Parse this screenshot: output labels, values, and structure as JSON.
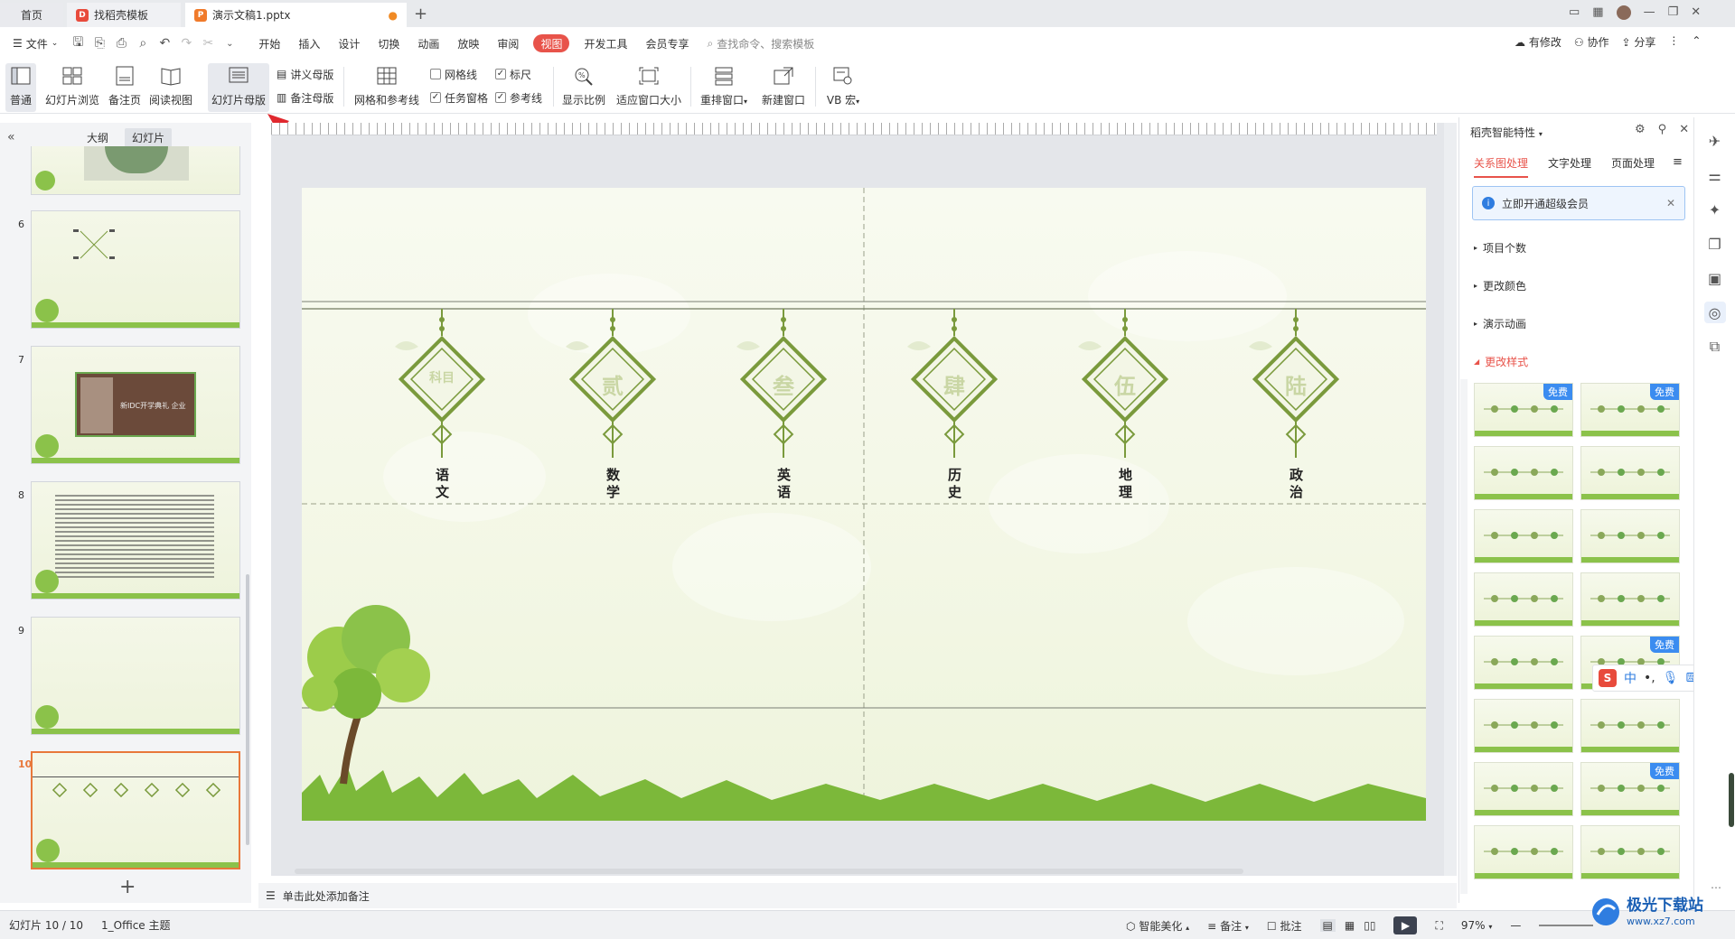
{
  "tabs": {
    "home": "首页",
    "docer": "找稻壳模板",
    "doc": "演示文稿1.pptx"
  },
  "menu": {
    "file": "文件",
    "items": [
      "开始",
      "插入",
      "设计",
      "切换",
      "动画",
      "放映",
      "审阅",
      "视图",
      "开发工具",
      "会员专享"
    ],
    "active": "视图",
    "search_placeholder": "查找命令、搜索模板",
    "right": [
      "有修改",
      "协作",
      "分享"
    ]
  },
  "ribbon": {
    "normal": "普通",
    "slide_sorter": "幻灯片浏览",
    "notes_page": "备注页",
    "reading_view": "阅读视图",
    "slide_master": "幻灯片母版",
    "handout_master": "讲义母版",
    "notes_master": "备注母版",
    "grid_guides": "网格和参考线",
    "gridlines": "网格线",
    "ruler": "标尺",
    "task_pane": "任务窗格",
    "guides": "参考线",
    "zoom": "显示比例",
    "fit_window": "适应窗口大小",
    "rearrange": "重排窗口",
    "new_window": "新建窗口",
    "vb_macro": "VB 宏"
  },
  "left_panel": {
    "tab_outline": "大纲",
    "tab_slides": "幻灯片",
    "slide_numbers": [
      "6",
      "7",
      "8",
      "9",
      "10"
    ],
    "thumb7_caption": "新IDC开学典礼 企业"
  },
  "slide": {
    "tags": [
      "科目",
      "贰",
      "叁",
      "肆",
      "伍",
      "陆"
    ],
    "subjects": [
      "语文",
      "数学",
      "英语",
      "历史",
      "地理",
      "政治"
    ]
  },
  "notes_placeholder": "单击此处添加备注",
  "right_panel": {
    "title": "稻壳智能特性",
    "tabs": [
      "关系图处理",
      "文字处理",
      "页面处理"
    ],
    "vip_banner": "立即开通超级会员",
    "sections": [
      "项目个数",
      "更改颜色",
      "演示动画",
      "更改样式"
    ],
    "free_badge": "免费"
  },
  "ime": {
    "label": "中"
  },
  "status": {
    "slide_info": "幻灯片 10 / 10",
    "theme": "1_Office 主题",
    "beautify": "智能美化",
    "notes": "备注",
    "comments": "批注",
    "zoom": "97%"
  },
  "watermark": {
    "name": "极光下载站",
    "url": "www.xz7.com"
  },
  "colors": {
    "accent": "#e8534a",
    "tag_green": "#7a9a3c",
    "selection_orange": "#e8783a"
  }
}
